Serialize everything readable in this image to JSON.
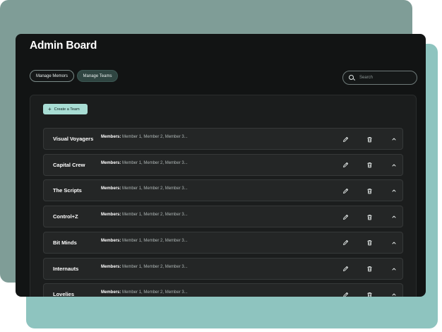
{
  "header": {
    "title": "Admin Board"
  },
  "nav": {
    "manage_memos": "Manage Memors",
    "manage_teams": "Manage Teams"
  },
  "search": {
    "placeholder": "Search"
  },
  "actions": {
    "create_team": "Create a Team"
  },
  "members_label": "Members:",
  "teams": [
    {
      "name": "Visual Voyagers",
      "members": "Member 1, Member 2, Member 3..."
    },
    {
      "name": "Capital Crew",
      "members": "Member 1, Member 2, Member 3..."
    },
    {
      "name": "The Scripts",
      "members": "Member 1, Member 2, Member 3..."
    },
    {
      "name": "Control+Z",
      "members": "Member 1, Member 2, Member 3..."
    },
    {
      "name": "Bit Minds",
      "members": "Member 1, Member 2, Member 3..."
    },
    {
      "name": "Internauts",
      "members": "Member 1, Member 2, Member 3..."
    },
    {
      "name": "Lovelies",
      "members": "Member 1, Member 2, Member 3..."
    }
  ],
  "colors": {
    "accent": "#a8ddd4",
    "background": "#121414",
    "panel": "#1b1d1d",
    "row": "#242626"
  },
  "icons": {
    "edit": "pencil-icon",
    "delete": "trash-icon",
    "collapse": "chevron-up-icon"
  }
}
